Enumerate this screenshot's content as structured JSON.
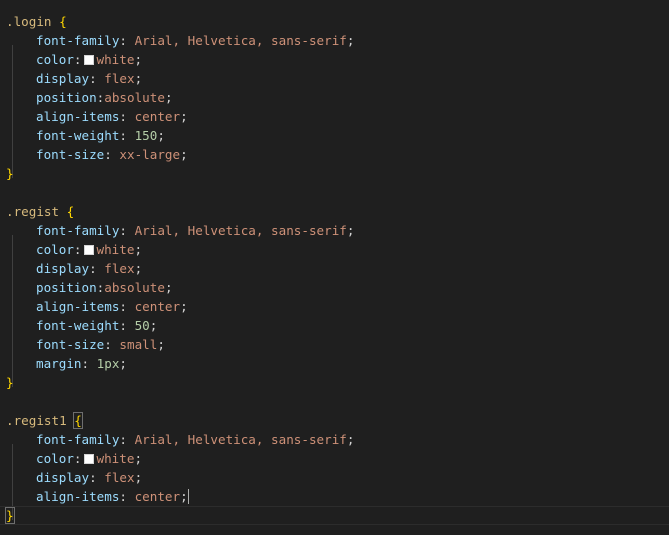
{
  "code": {
    "rules": [
      {
        "selector": ".login",
        "decls": [
          {
            "prop": "font-family",
            "sep": ": ",
            "value": "Arial, Helvetica, sans-serif",
            "type": "str"
          },
          {
            "prop": "color",
            "sep": ":",
            "value": "white",
            "type": "color",
            "swatch": "#ffffff"
          },
          {
            "prop": "display",
            "sep": ": ",
            "value": "flex",
            "type": "str"
          },
          {
            "prop": "position",
            "sep": ":",
            "value": "absolute",
            "type": "str"
          },
          {
            "prop": "align-items",
            "sep": ": ",
            "value": "center",
            "type": "str"
          },
          {
            "prop": "font-weight",
            "sep": ": ",
            "value": "150",
            "type": "num"
          },
          {
            "prop": "font-size",
            "sep": ": ",
            "value": "xx-large",
            "type": "str"
          }
        ]
      },
      {
        "selector": ".regist",
        "decls": [
          {
            "prop": "font-family",
            "sep": ": ",
            "value": "Arial, Helvetica, sans-serif",
            "type": "str"
          },
          {
            "prop": "color",
            "sep": ":",
            "value": "white",
            "type": "color",
            "swatch": "#ffffff"
          },
          {
            "prop": "display",
            "sep": ": ",
            "value": "flex",
            "type": "str"
          },
          {
            "prop": "position",
            "sep": ":",
            "value": "absolute",
            "type": "str"
          },
          {
            "prop": "align-items",
            "sep": ": ",
            "value": "center",
            "type": "str"
          },
          {
            "prop": "font-weight",
            "sep": ": ",
            "value": "50",
            "type": "num"
          },
          {
            "prop": "font-size",
            "sep": ": ",
            "value": "small",
            "type": "str"
          },
          {
            "prop": "margin",
            "sep": ": ",
            "value": "1px",
            "type": "num"
          }
        ]
      },
      {
        "selector": ".regist1",
        "active": true,
        "decls": [
          {
            "prop": "font-family",
            "sep": ": ",
            "value": "Arial, Helvetica, sans-serif",
            "type": "str"
          },
          {
            "prop": "color",
            "sep": ":",
            "value": "white",
            "type": "color",
            "swatch": "#ffffff"
          },
          {
            "prop": "display",
            "sep": ": ",
            "value": "flex",
            "type": "str"
          },
          {
            "prop": "align-items",
            "sep": ": ",
            "value": "center",
            "type": "str"
          }
        ]
      }
    ]
  },
  "colors": {
    "background": "#1f1f1f",
    "selector": "#d7ba7d",
    "brace": "#ffd700",
    "property": "#9cdcfe",
    "string_value": "#ce9178",
    "number_value": "#b5cea8"
  }
}
